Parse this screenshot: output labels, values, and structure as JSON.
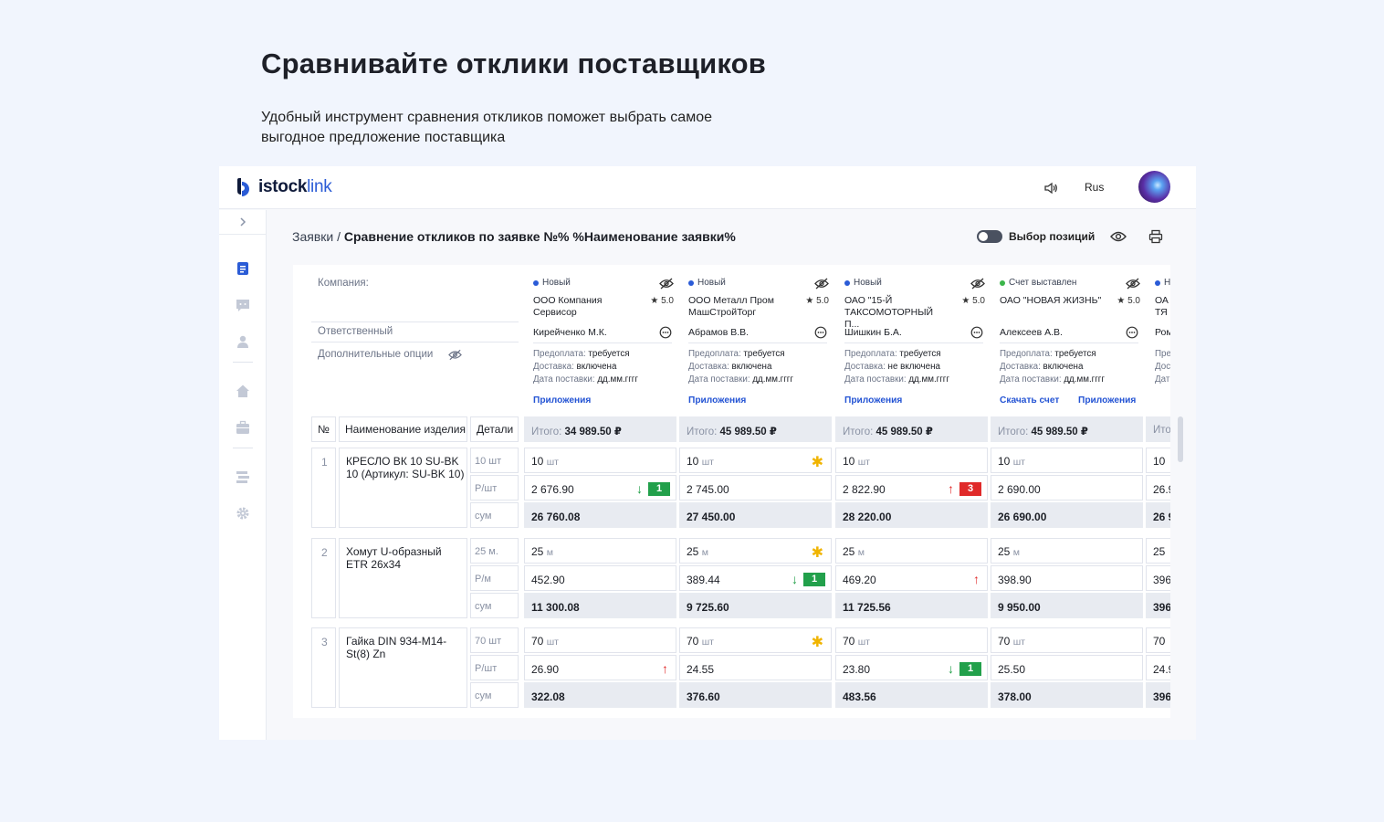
{
  "hero": {
    "title": "Сравнивайте отклики поставщиков",
    "subtitle_line1": "Удобный инструмент сравнения откликов  поможет выбрать самое",
    "subtitle_line2": "выгодное предложение поставщика"
  },
  "topbar": {
    "logo_bold": "istock",
    "logo_light": "link",
    "lang": "Rus",
    "icons": [
      "sound-icon",
      "avatar"
    ]
  },
  "sidebar": {
    "icons": [
      "chevron-right-icon",
      "document-icon",
      "chat-icon",
      "user-icon",
      "home-icon",
      "briefcase-icon",
      "list-icon",
      "gear-icon"
    ]
  },
  "header": {
    "breadcrumb_root": "Заявки",
    "breadcrumb_sep": " / ",
    "breadcrumb_current": "Сравнение откликов по заявке №% %Наименование заявки%",
    "toggle_label": "Выбор позиций",
    "toggle_on": false
  },
  "labels": {
    "company": "Компания:",
    "responsible": "Ответственный",
    "extra_options": "Дополнительные опции"
  },
  "columns": {
    "num": "№",
    "product": "Наименование изделия",
    "details": "Детали"
  },
  "option_labels": {
    "prepay": "Предоплата: ",
    "delivery": "Доставка: ",
    "date": "Дата поставки: "
  },
  "total_label": "Итого:",
  "suppliers": [
    {
      "status": "Новый",
      "status_color": "#2a5bd7",
      "name_line1": "ООО Компания",
      "name_line2": "Сервисор",
      "rating": "★ 5.0",
      "responsible": "Кирейченко М.К.",
      "prepay": "требуется",
      "delivery": "включена",
      "date": "дд.мм.гггг",
      "links": [
        "Приложения"
      ],
      "total": "34 989.50 ₽"
    },
    {
      "status": "Новый",
      "status_color": "#2a5bd7",
      "name_line1": "ООО Металл Пром",
      "name_line2": "МашСтройТорг",
      "rating": "★ 5.0",
      "responsible": "Абрамов В.В.",
      "prepay": "требуется",
      "delivery": "включена",
      "date": "дд.мм.гггг",
      "links": [
        "Приложения"
      ],
      "total": "45 989.50 ₽"
    },
    {
      "status": "Новый",
      "status_color": "#2a5bd7",
      "name_line1": "ОАО \"15-Й",
      "name_line2": "ТАКСОМОТОРНЫЙ П...",
      "rating": "★ 5.0",
      "responsible": "Шишкин Б.А.",
      "prepay": "требуется",
      "delivery": "не включена",
      "date": "дд.мм.гггг",
      "links": [
        "Приложения"
      ],
      "total": "45 989.50 ₽"
    },
    {
      "status": "Счет выставлен",
      "status_color": "#3bb54a",
      "name_line1": "ОАО \"НОВАЯ ЖИЗНЬ\"",
      "name_line2": "",
      "rating": "★ 5.0",
      "responsible": "Алексеев А.В.",
      "prepay": "требуется",
      "delivery": "включена",
      "date": "дд.мм.гггг",
      "links": [
        "Скачать счет",
        "Приложения"
      ],
      "total": "45 989.50 ₽"
    },
    {
      "status": "Н",
      "status_color": "#2a5bd7",
      "name_line1": "ОА",
      "name_line2": "ТЯ",
      "rating": "",
      "responsible": "Ром",
      "prepay": "",
      "delivery": "",
      "date": "",
      "links": [],
      "total": "Итог",
      "partial": true
    }
  ],
  "rows": [
    {
      "num": "1",
      "name": "КРЕСЛО ВК 10 SU-BK 10 (Артикул: SU-BK 10)",
      "qty_label": "10 шт",
      "price_label": "Р/шт",
      "sum_label": "сум",
      "offers": [
        {
          "qty": "10",
          "unit": "шт",
          "price": "2 676.90",
          "trend": "down",
          "rank": "1",
          "sum": "26 760.08"
        },
        {
          "qty": "10",
          "unit": "шт",
          "price": "2 745.00",
          "star": true,
          "sum": "27 450.00"
        },
        {
          "qty": "10",
          "unit": "шт",
          "price": "2 822.90",
          "trend": "up",
          "rank": "3",
          "sum": "28 220.00"
        },
        {
          "qty": "10",
          "unit": "шт",
          "price": "2 690.00",
          "sum": "26 690.00"
        },
        {
          "qty": "10",
          "unit": "",
          "price": "26.9",
          "sum": "26 9"
        }
      ]
    },
    {
      "num": "2",
      "name": "Хомут U-образный ETR 26x34",
      "qty_label": "25 м.",
      "price_label": "Р/м",
      "sum_label": "сум",
      "offers": [
        {
          "qty": "25",
          "unit": "м",
          "price": "452.90",
          "sum": "11 300.08"
        },
        {
          "qty": "25",
          "unit": "м",
          "price": "389.44",
          "star": true,
          "trend": "down",
          "rank": "1",
          "sum": "9 725.60"
        },
        {
          "qty": "25",
          "unit": "м",
          "price": "469.20",
          "trend": "up",
          "sum": "11 725.56"
        },
        {
          "qty": "25",
          "unit": "м",
          "price": "398.90",
          "sum": "9 950.00"
        },
        {
          "qty": "25",
          "unit": "",
          "price": "396",
          "sum": "396"
        }
      ]
    },
    {
      "num": "3",
      "name": "Гайка DIN 934-M14-St(8) Zn",
      "qty_label": "70 шт",
      "price_label": "Р/шт",
      "sum_label": "сум",
      "offers": [
        {
          "qty": "70",
          "unit": "шт",
          "price": "26.90",
          "trend": "up",
          "sum": "322.08"
        },
        {
          "qty": "70",
          "unit": "шт",
          "price": "24.55",
          "star": true,
          "sum": "376.60"
        },
        {
          "qty": "70",
          "unit": "шт",
          "price": "23.80",
          "trend": "down",
          "rank": "1",
          "sum": "483.56"
        },
        {
          "qty": "70",
          "unit": "шт",
          "price": "25.50",
          "sum": "378.00"
        },
        {
          "qty": "70",
          "unit": "",
          "price": "24.9",
          "sum": "396"
        }
      ]
    }
  ],
  "colors": {
    "accent": "#2454d4",
    "background": "#f1f5fd",
    "rank_good": "#22a04b",
    "rank_bad": "#e02a2a",
    "star": "#f0b400"
  }
}
